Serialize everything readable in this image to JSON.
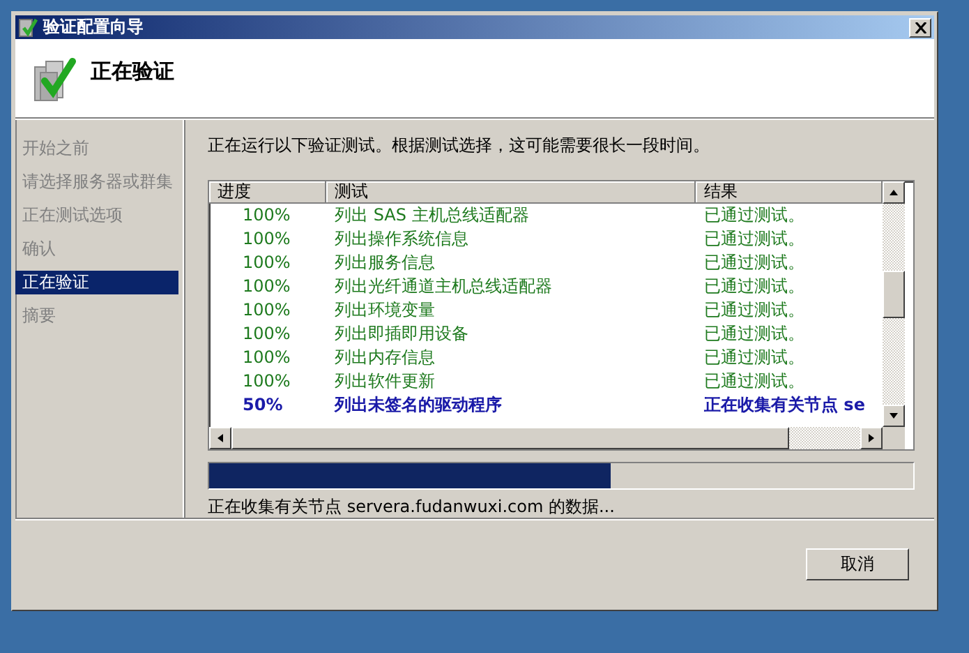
{
  "window": {
    "title": "验证配置向导"
  },
  "header": {
    "title": "正在验证"
  },
  "nav": [
    {
      "label": "开始之前",
      "selected": false
    },
    {
      "label": "请选择服务器或群集",
      "selected": false
    },
    {
      "label": "正在测试选项",
      "selected": false
    },
    {
      "label": "确认",
      "selected": false
    },
    {
      "label": "正在验证",
      "selected": true
    },
    {
      "label": "摘要",
      "selected": false
    }
  ],
  "intro": "正在运行以下验证测试。根据测试选择，这可能需要很长一段时间。",
  "table": {
    "columns": [
      "进度",
      "测试",
      "结果"
    ],
    "rows": [
      {
        "progress": "100%",
        "test": "列出 SAS 主机总线适配器",
        "result": "已通过测试。",
        "kind": "passed"
      },
      {
        "progress": "100%",
        "test": "列出操作系统信息",
        "result": "已通过测试。",
        "kind": "passed"
      },
      {
        "progress": "100%",
        "test": "列出服务信息",
        "result": "已通过测试。",
        "kind": "passed"
      },
      {
        "progress": "100%",
        "test": "列出光纤通道主机总线适配器",
        "result": "已通过测试。",
        "kind": "passed"
      },
      {
        "progress": "100%",
        "test": "列出环境变量",
        "result": "已通过测试。",
        "kind": "passed"
      },
      {
        "progress": "100%",
        "test": "列出即插即用设备",
        "result": "已通过测试。",
        "kind": "passed"
      },
      {
        "progress": "100%",
        "test": "列出内存信息",
        "result": "已通过测试。",
        "kind": "passed"
      },
      {
        "progress": "100%",
        "test": "列出软件更新",
        "result": "已通过测试。",
        "kind": "passed"
      },
      {
        "progress": "50%",
        "test": "列出未签名的驱动程序",
        "result": "正在收集有关节点 se",
        "kind": "running"
      }
    ]
  },
  "progress": {
    "level": 0.57
  },
  "status_text": "正在收集有关节点 servera.fudanwuxi.com 的数据...",
  "buttons": [
    {
      "label": "取消"
    }
  ]
}
